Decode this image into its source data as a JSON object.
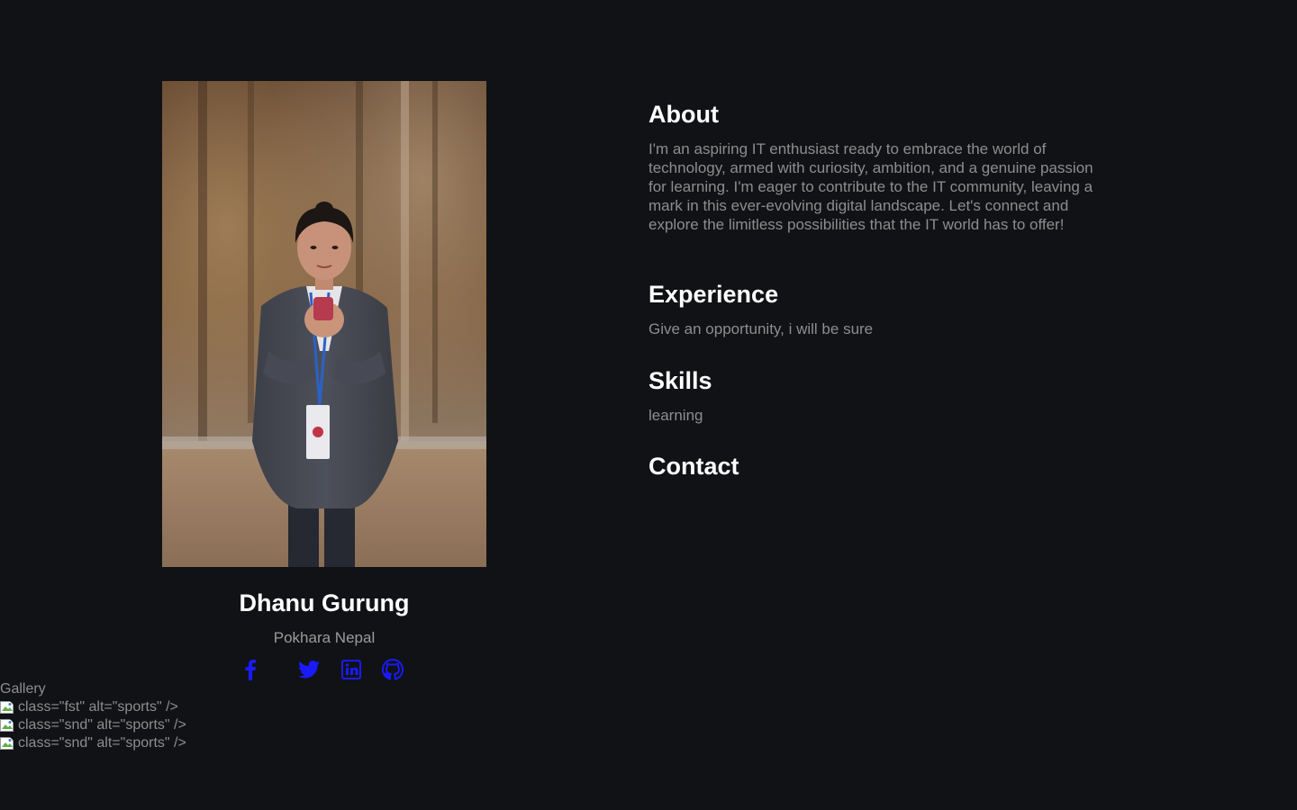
{
  "profile": {
    "name": "Dhanu Gurung",
    "location": "Pokhara Nepal",
    "photo_description": "portrait"
  },
  "social": [
    {
      "name": "facebook",
      "icon": "facebook-icon",
      "color": "#1a1aff"
    },
    {
      "name": "twitter",
      "icon": "twitter-icon",
      "color": "#1a1aff"
    },
    {
      "name": "linkedin",
      "icon": "linkedin-icon",
      "color": "#1a1aff"
    },
    {
      "name": "github",
      "icon": "github-icon",
      "color": "#1a1aff"
    }
  ],
  "about": {
    "heading": "About",
    "text": "I'm an aspiring IT enthusiast ready to embrace the world of technology, armed with curiosity, ambition, and a genuine passion for learning. I'm eager to contribute to the IT community, leaving a mark in this ever-evolving digital landscape. Let's connect and explore the limitless possibilities that the IT world has to offer!"
  },
  "experience": {
    "heading": "Experience",
    "text": "Give an opportunity, i will be sure"
  },
  "skills": {
    "heading": "Skills",
    "text": "learning"
  },
  "contact": {
    "heading": "Contact"
  },
  "gallery": {
    "label": "Gallery",
    "items": [
      "class=\"fst\" alt=\"sports\" />",
      "class=\"snd\" alt=\"sports\" />",
      "class=\"snd\" alt=\"sports\" />"
    ]
  },
  "colors": {
    "background": "#111215",
    "heading": "#ffffff",
    "muted_text": "#8d8d8d",
    "link_icon": "#1a1aff"
  }
}
